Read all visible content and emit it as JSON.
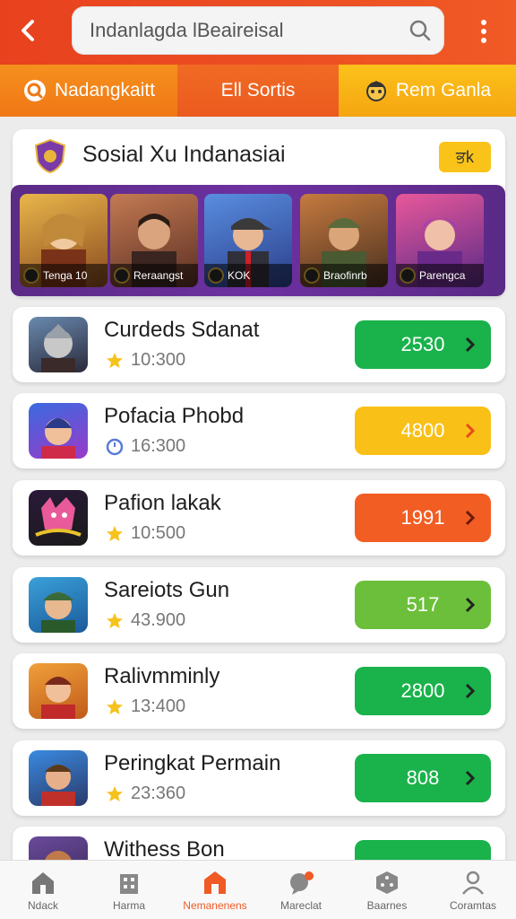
{
  "header": {
    "search_text": "Indanlagda lBeaireisal",
    "back_icon": "arrow-left-icon",
    "search_icon": "search-icon",
    "menu_icon": "more-vertical-icon"
  },
  "tabs": [
    {
      "label": "Nadangkaitt",
      "icon": "search-icon"
    },
    {
      "label": "Ell Sortis"
    },
    {
      "label": "Rem Ganla",
      "icon": "mascot-icon"
    }
  ],
  "featured": {
    "title": "Sosial  Xu Indanasiai",
    "badge": "ਭk",
    "heroes": [
      {
        "label": "Tenga 10"
      },
      {
        "label": "Reraangst"
      },
      {
        "label": "KOK"
      },
      {
        "label": "Braofinrb"
      },
      {
        "label": "Parengca"
      }
    ]
  },
  "list": [
    {
      "name": "Curdeds Sdanat",
      "meta": "10:300",
      "meta_icon": "star-icon",
      "value": "2530",
      "color": "#19b24b"
    },
    {
      "name": "Pofacia Phobd",
      "meta": "16:300",
      "meta_icon": "clock-icon",
      "value": "4800",
      "color": "#f9c018"
    },
    {
      "name": "Pafion lakak",
      "meta": "10:500",
      "meta_icon": "star-icon",
      "value": "1991",
      "color": "#f25d23"
    },
    {
      "name": "Sareiots Gun",
      "meta": "43.900",
      "meta_icon": "star-icon",
      "value": "517",
      "color": "#6cbf3a"
    },
    {
      "name": "Ralivmminly",
      "meta": "13:400",
      "meta_icon": "star-icon",
      "value": "2800",
      "color": "#19b24b"
    },
    {
      "name": "Peringkat Permain",
      "meta": "23:360",
      "meta_icon": "star-icon",
      "value": "808",
      "color": "#19b24b"
    },
    {
      "name": "Withess Bon",
      "meta": "",
      "meta_icon": "star-icon",
      "value": "",
      "color": "#19b24b"
    }
  ],
  "bottom_nav": [
    {
      "label": "Ndack",
      "icon": "home-icon"
    },
    {
      "label": "Harma",
      "icon": "building-icon"
    },
    {
      "label": "Nemanenens",
      "icon": "store-icon",
      "active": true
    },
    {
      "label": "Mareclat",
      "icon": "chat-icon"
    },
    {
      "label": "Baarnes",
      "icon": "dice-icon"
    },
    {
      "label": "Coramtas",
      "icon": "user-icon"
    }
  ]
}
